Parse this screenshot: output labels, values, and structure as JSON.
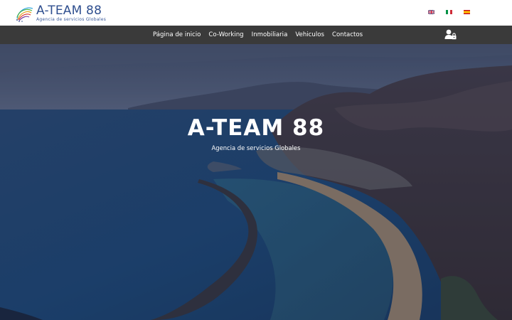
{
  "header": {
    "logo": {
      "title": "A-TEAM 88",
      "subtitle": "Agencia de servicios Globales",
      "mark_icon": "spiral-dots-logo-icon"
    },
    "languages": [
      {
        "code": "en",
        "icon": "uk-flag-icon"
      },
      {
        "code": "it",
        "icon": "italy-flag-icon"
      },
      {
        "code": "es",
        "icon": "spain-flag-icon"
      }
    ]
  },
  "nav": {
    "items": [
      {
        "label": "Página de inicio"
      },
      {
        "label": "Co-Working"
      },
      {
        "label": "Inmobiliaria"
      },
      {
        "label": "Vehiculos"
      },
      {
        "label": "Contactos"
      }
    ],
    "user_icon": "user-lock-icon"
  },
  "hero": {
    "title": "A-TEAM 88",
    "subtitle": "Agencia de servicios Globales",
    "background": "coastal-bay-photo"
  },
  "colors": {
    "brand_blue": "#2f4f8f",
    "navbar_bg": "#3a3a3a",
    "hero_overlay": "#1c2a4a"
  }
}
